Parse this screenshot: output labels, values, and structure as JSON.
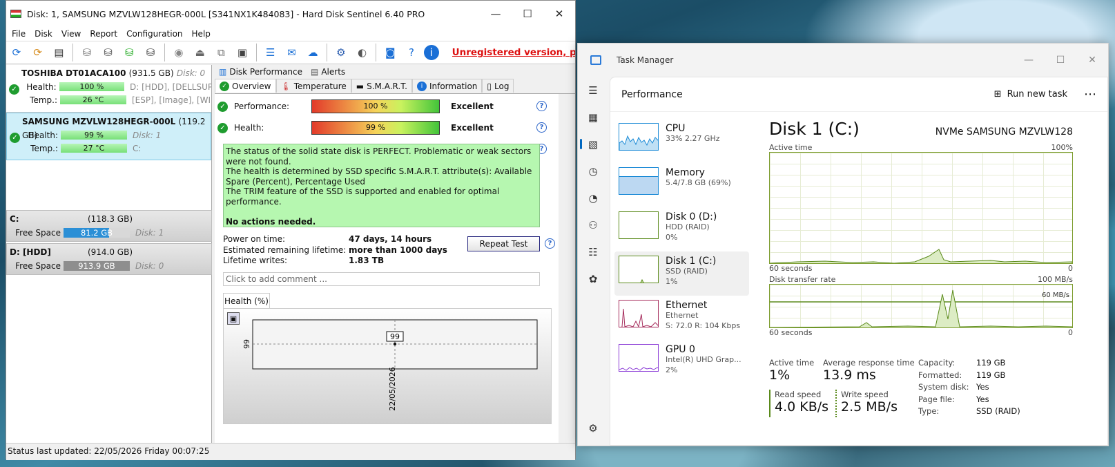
{
  "hds": {
    "title": "Disk: 1, SAMSUNG MZVLW128HEGR-000L [S341NX1K484083]  -  Hard Disk Sentinel 6.40 PRO",
    "menu": [
      "File",
      "Disk",
      "View",
      "Report",
      "Configuration",
      "Help"
    ],
    "unregistered": "Unregistered version, p",
    "disks": [
      {
        "name": "TOSHIBA DT01ACA100",
        "size": "(931.5 GB)",
        "disk_no": "Disk: 0",
        "health_label": "Health:",
        "health": "100 %",
        "health_extra": "D: [HDD],  [DELLSUP",
        "temp_label": "Temp.:",
        "temp": "26 °C",
        "temp_extra": "[ESP],  [Image],  [WI"
      },
      {
        "name": "SAMSUNG MZVLW128HEGR-000L",
        "size": "(119.2 GB)",
        "disk_no": "",
        "health_label": "Health:",
        "health": "99 %",
        "health_extra": "Disk: 1",
        "temp_label": "Temp.:",
        "temp": "27 °C",
        "temp_extra": "C:"
      }
    ],
    "partitions": [
      {
        "name": "C:",
        "size": "(118.3 GB)",
        "free_label": "Free Space",
        "free": "81.2 GB",
        "disk": "Disk: 1",
        "free_pct": 0.69,
        "color": "#2b8fd6"
      },
      {
        "name": "D: [HDD]",
        "size": "(914.0 GB)",
        "free_label": "Free Space",
        "free": "913.9 GB",
        "disk": "Disk: 0",
        "free_pct": 1.0,
        "color": "#8e8e8e"
      }
    ],
    "status": "Status last updated: 22/05/2026 Friday 00:07:25",
    "tabs_top": [
      "Disk Performance",
      "Alerts"
    ],
    "tabs": [
      "Overview",
      "Temperature",
      "S.M.A.R.T.",
      "Information",
      "Log"
    ],
    "performance_label": "Performance:",
    "performance_value": "100 %",
    "performance_text": "Excellent",
    "health_label": "Health:",
    "health_value": "99 %",
    "health_text": "Excellent",
    "message": [
      "The status of the solid state disk is PERFECT. Problematic or weak sectors were not found.",
      "The health is determined by SSD specific S.M.A.R.T. attribute(s):  Available Spare (Percent), Percentage Used",
      "The TRIM feature of the SSD is supported and enabled for optimal performance.",
      "",
      "No actions needed."
    ],
    "power_on_label": "Power on time:",
    "power_on": "47 days, 14 hours",
    "remaining_label": "Estimated remaining lifetime:",
    "remaining": "more than 1000 days",
    "writes_label": "Lifetime writes:",
    "writes": "1.83 TB",
    "repeat_test": "Repeat Test",
    "comment_placeholder": "Click to add comment ...",
    "chart_tab": "Health (%)",
    "chart_point_label": "99",
    "chart_y_tick": "99",
    "chart_x_tick": "22/05/2026"
  },
  "tm": {
    "title": "Task Manager",
    "section": "Performance",
    "run_new_task": "Run new task",
    "resources": [
      {
        "name": "CPU",
        "sub1": "33%  2.27 GHz",
        "sub2": "",
        "sub3": ""
      },
      {
        "name": "Memory",
        "sub1": "5.4/7.8 GB (69%)",
        "sub2": "",
        "sub3": ""
      },
      {
        "name": "Disk 0 (D:)",
        "sub1": "HDD (RAID)",
        "sub2": "0%",
        "sub3": ""
      },
      {
        "name": "Disk 1 (C:)",
        "sub1": "SSD (RAID)",
        "sub2": "1%",
        "sub3": ""
      },
      {
        "name": "Ethernet",
        "sub1": "Ethernet",
        "sub2": "S: 72.0  R: 104 Kbps",
        "sub3": ""
      },
      {
        "name": "GPU 0",
        "sub1": "Intel(R) UHD Grap...",
        "sub2": "2%",
        "sub3": ""
      }
    ],
    "detail_title": "Disk 1 (C:)",
    "detail_model": "NVMe SAMSUNG MZVLW128",
    "active_time_label": "Active time",
    "active_time_max": "100%",
    "sixty_seconds": "60 seconds",
    "zero": "0",
    "transfer_label": "Disk transfer rate",
    "transfer_max": "100 MB/s",
    "transfer_marker": "60 MB/s",
    "stat_active_label": "Active time",
    "stat_active": "1%",
    "stat_resp_label": "Average response time",
    "stat_resp": "13.9 ms",
    "read_label": "Read speed",
    "read": "4.0 KB/s",
    "write_label": "Write speed",
    "write": "2.5 MB/s",
    "props": [
      {
        "k": "Capacity:",
        "v": "119 GB"
      },
      {
        "k": "Formatted:",
        "v": "119 GB"
      },
      {
        "k": "System disk:",
        "v": "Yes"
      },
      {
        "k": "Page file:",
        "v": "Yes"
      },
      {
        "k": "Type:",
        "v": "SSD (RAID)"
      }
    ]
  }
}
